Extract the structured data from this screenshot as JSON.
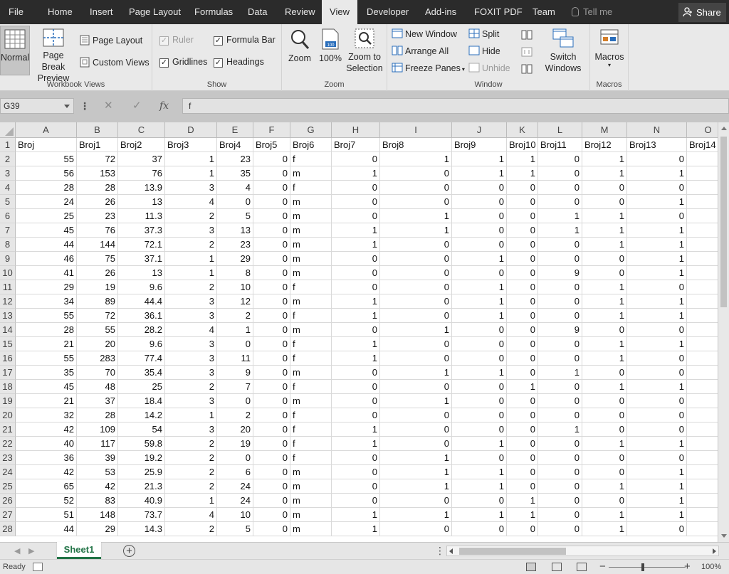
{
  "tabs": [
    "File",
    "Home",
    "Insert",
    "Page Layout",
    "Formulas",
    "Data",
    "Review",
    "View",
    "Developer",
    "Add-ins",
    "FOXIT PDF",
    "Team"
  ],
  "active_tab": "View",
  "tell_me": "Tell me",
  "share": "Share",
  "ribbon": {
    "workbook_views": {
      "title": "Workbook Views",
      "normal": "Normal",
      "page_break_preview": "Page Break Preview",
      "page_layout": "Page Layout",
      "custom_views": "Custom Views"
    },
    "show": {
      "title": "Show",
      "ruler": "Ruler",
      "formula_bar": "Formula Bar",
      "gridlines": "Gridlines",
      "headings": "Headings"
    },
    "zoom": {
      "title": "Zoom",
      "zoom": "Zoom",
      "zoom_100": "100%",
      "zoom_to_selection": "Zoom to Selection"
    },
    "window": {
      "title": "Window",
      "new_window": "New Window",
      "arrange_all": "Arrange All",
      "freeze_panes": "Freeze Panes",
      "split": "Split",
      "hide": "Hide",
      "unhide": "Unhide",
      "switch_windows": "Switch Windows"
    },
    "macros": {
      "title": "Macros",
      "macros": "Macros"
    }
  },
  "formula_bar": {
    "name_box": "G39",
    "fx": "fx",
    "value": "f"
  },
  "columns": [
    "A",
    "B",
    "C",
    "D",
    "E",
    "F",
    "G",
    "H",
    "I",
    "J",
    "K",
    "L",
    "M",
    "N",
    "O"
  ],
  "rows": [
    [
      "Broj",
      "Broj1",
      "Broj2",
      "Broj3",
      "Broj4",
      "Broj5",
      "Broj6",
      "Broj7",
      "Broj8",
      "Broj9",
      "Broj10",
      "Broj11",
      "Broj12",
      "Broj13",
      "Broj14"
    ],
    [
      "55",
      "72",
      "37",
      "1",
      "23",
      "0",
      "f",
      "0",
      "1",
      "1",
      "1",
      "0",
      "1",
      "0",
      ""
    ],
    [
      "56",
      "153",
      "76",
      "1",
      "35",
      "0",
      "m",
      "1",
      "0",
      "1",
      "1",
      "0",
      "1",
      "1",
      ""
    ],
    [
      "28",
      "28",
      "13.9",
      "3",
      "4",
      "0",
      "f",
      "0",
      "0",
      "0",
      "0",
      "0",
      "0",
      "0",
      ""
    ],
    [
      "24",
      "26",
      "13",
      "4",
      "0",
      "0",
      "m",
      "0",
      "0",
      "0",
      "0",
      "0",
      "0",
      "1",
      ""
    ],
    [
      "25",
      "23",
      "11.3",
      "2",
      "5",
      "0",
      "m",
      "0",
      "1",
      "0",
      "0",
      "1",
      "1",
      "0",
      ""
    ],
    [
      "45",
      "76",
      "37.3",
      "3",
      "13",
      "0",
      "m",
      "1",
      "1",
      "0",
      "0",
      "1",
      "1",
      "1",
      ""
    ],
    [
      "44",
      "144",
      "72.1",
      "2",
      "23",
      "0",
      "m",
      "1",
      "0",
      "0",
      "0",
      "0",
      "1",
      "1",
      ""
    ],
    [
      "46",
      "75",
      "37.1",
      "1",
      "29",
      "0",
      "m",
      "0",
      "0",
      "1",
      "0",
      "0",
      "0",
      "1",
      ""
    ],
    [
      "41",
      "26",
      "13",
      "1",
      "8",
      "0",
      "m",
      "0",
      "0",
      "0",
      "0",
      "9",
      "0",
      "1",
      ""
    ],
    [
      "29",
      "19",
      "9.6",
      "2",
      "10",
      "0",
      "f",
      "0",
      "0",
      "1",
      "0",
      "0",
      "1",
      "0",
      ""
    ],
    [
      "34",
      "89",
      "44.4",
      "3",
      "12",
      "0",
      "m",
      "1",
      "0",
      "1",
      "0",
      "0",
      "1",
      "1",
      ""
    ],
    [
      "55",
      "72",
      "36.1",
      "3",
      "2",
      "0",
      "f",
      "1",
      "0",
      "1",
      "0",
      "0",
      "1",
      "1",
      ""
    ],
    [
      "28",
      "55",
      "28.2",
      "4",
      "1",
      "0",
      "m",
      "0",
      "1",
      "0",
      "0",
      "9",
      "0",
      "0",
      ""
    ],
    [
      "21",
      "20",
      "9.6",
      "3",
      "0",
      "0",
      "f",
      "1",
      "0",
      "0",
      "0",
      "0",
      "1",
      "1",
      ""
    ],
    [
      "55",
      "283",
      "77.4",
      "3",
      "11",
      "0",
      "f",
      "1",
      "0",
      "0",
      "0",
      "0",
      "1",
      "0",
      ""
    ],
    [
      "35",
      "70",
      "35.4",
      "3",
      "9",
      "0",
      "m",
      "0",
      "1",
      "1",
      "0",
      "1",
      "0",
      "0",
      ""
    ],
    [
      "45",
      "48",
      "25",
      "2",
      "7",
      "0",
      "f",
      "0",
      "0",
      "0",
      "1",
      "0",
      "1",
      "1",
      ""
    ],
    [
      "21",
      "37",
      "18.4",
      "3",
      "0",
      "0",
      "m",
      "0",
      "1",
      "0",
      "0",
      "0",
      "0",
      "0",
      ""
    ],
    [
      "32",
      "28",
      "14.2",
      "1",
      "2",
      "0",
      "f",
      "0",
      "0",
      "0",
      "0",
      "0",
      "0",
      "0",
      ""
    ],
    [
      "42",
      "109",
      "54",
      "3",
      "20",
      "0",
      "f",
      "1",
      "0",
      "0",
      "0",
      "1",
      "0",
      "0",
      ""
    ],
    [
      "40",
      "117",
      "59.8",
      "2",
      "19",
      "0",
      "f",
      "1",
      "0",
      "1",
      "0",
      "0",
      "1",
      "1",
      ""
    ],
    [
      "36",
      "39",
      "19.2",
      "2",
      "0",
      "0",
      "f",
      "0",
      "1",
      "0",
      "0",
      "0",
      "0",
      "0",
      ""
    ],
    [
      "42",
      "53",
      "25.9",
      "2",
      "6",
      "0",
      "m",
      "0",
      "1",
      "1",
      "0",
      "0",
      "0",
      "1",
      ""
    ],
    [
      "65",
      "42",
      "21.3",
      "2",
      "24",
      "0",
      "m",
      "0",
      "1",
      "1",
      "0",
      "0",
      "1",
      "1",
      ""
    ],
    [
      "52",
      "83",
      "40.9",
      "1",
      "24",
      "0",
      "m",
      "0",
      "0",
      "0",
      "1",
      "0",
      "0",
      "1",
      ""
    ],
    [
      "51",
      "148",
      "73.7",
      "4",
      "10",
      "0",
      "m",
      "1",
      "1",
      "1",
      "1",
      "0",
      "1",
      "1",
      ""
    ],
    [
      "44",
      "29",
      "14.3",
      "2",
      "5",
      "0",
      "m",
      "1",
      "0",
      "0",
      "0",
      "0",
      "1",
      "0",
      ""
    ]
  ],
  "sheet_tab": "Sheet1",
  "status": {
    "ready": "Ready",
    "zoom": "100%"
  },
  "colors": {
    "tabbar": "#2b2b2b",
    "ribbon": "#e9e9e9",
    "excel_green": "#217346"
  }
}
